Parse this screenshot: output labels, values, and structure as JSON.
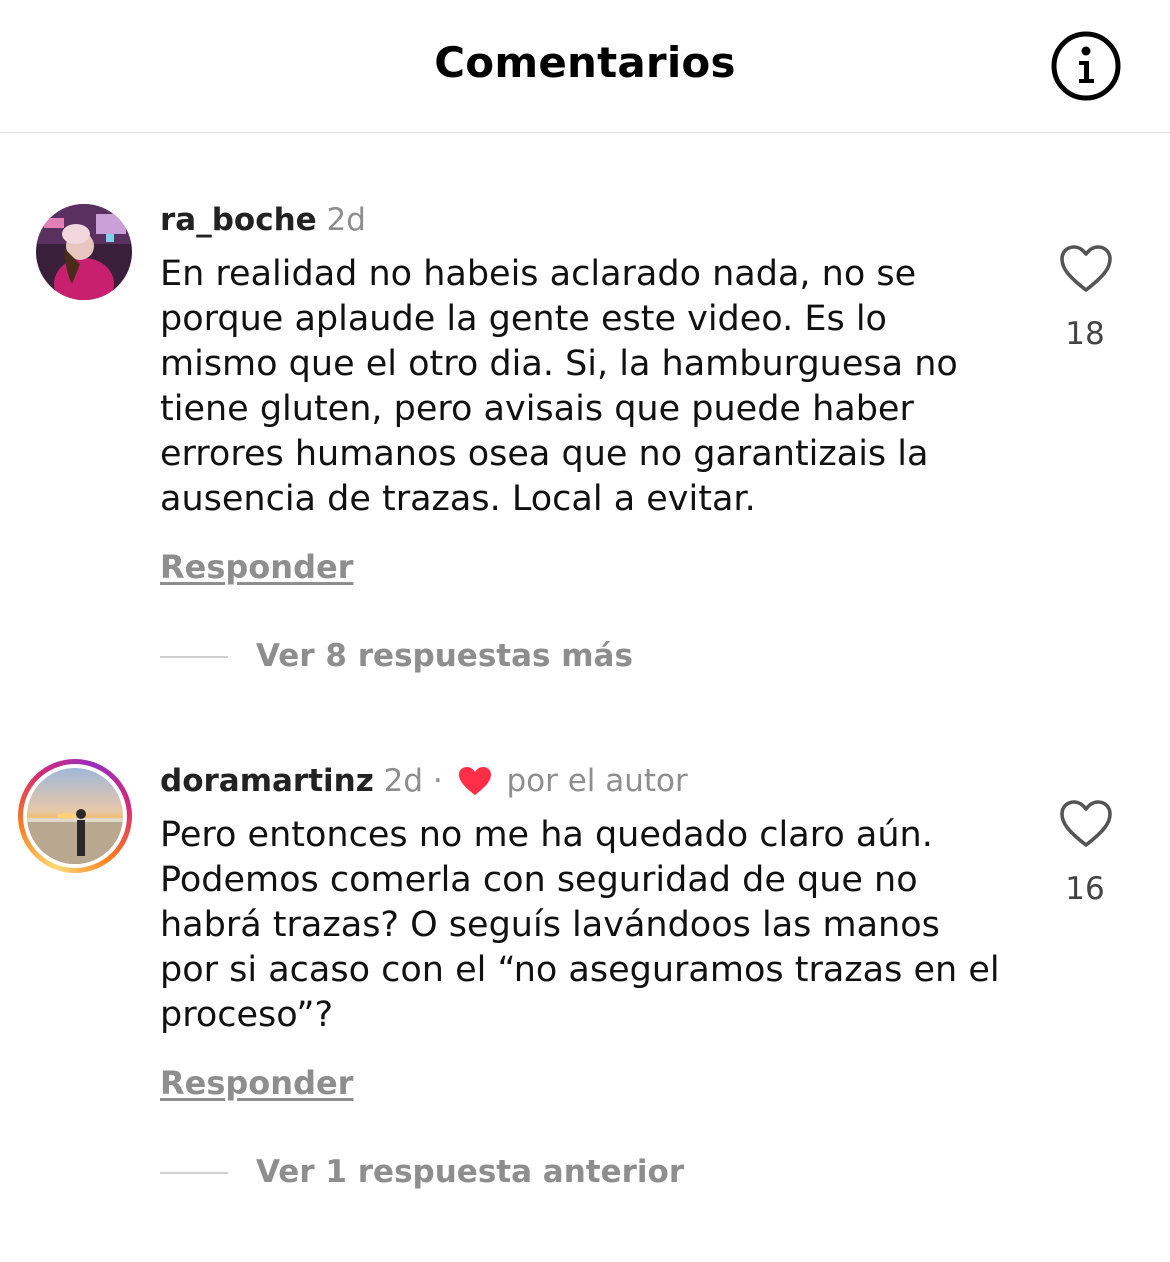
{
  "header": {
    "title": "Comentarios",
    "info_icon": "info-circle-icon"
  },
  "comments": [
    {
      "username": "ra_boche",
      "time": "2d",
      "text": "En realidad no habeis aclarado nada, no se porque aplaude la gente este video. Es lo mismo que el otro dia. Si, la hamburguesa no tiene gluten, pero avisais que puede haber errores humanos osea que no garantizais la ausencia de trazas. Local a evitar.",
      "reply_label": "Responder",
      "view_replies_label": "Ver 8 respuestas más",
      "like_count": "18",
      "avatar_icon": "avatar-photo"
    },
    {
      "username": "doramartinz",
      "time": "2d",
      "separator": "·",
      "author_note": "por el autor",
      "text": "Pero entonces no me ha quedado claro aún. Podemos comerla con seguridad de que no habrá trazas? O seguís lavándoos las manos por si acaso con el “no aseguramos trazas en el proceso”?",
      "reply_label": "Responder",
      "view_replies_label": "Ver 1 respuesta anterior",
      "like_count": "16",
      "avatar_icon": "avatar-photo-story-ring"
    }
  ],
  "colors": {
    "text_primary": "#111111",
    "text_secondary": "#8e8e8e",
    "author_heart": "#ff2d46",
    "divider": "#dcdcdc"
  }
}
